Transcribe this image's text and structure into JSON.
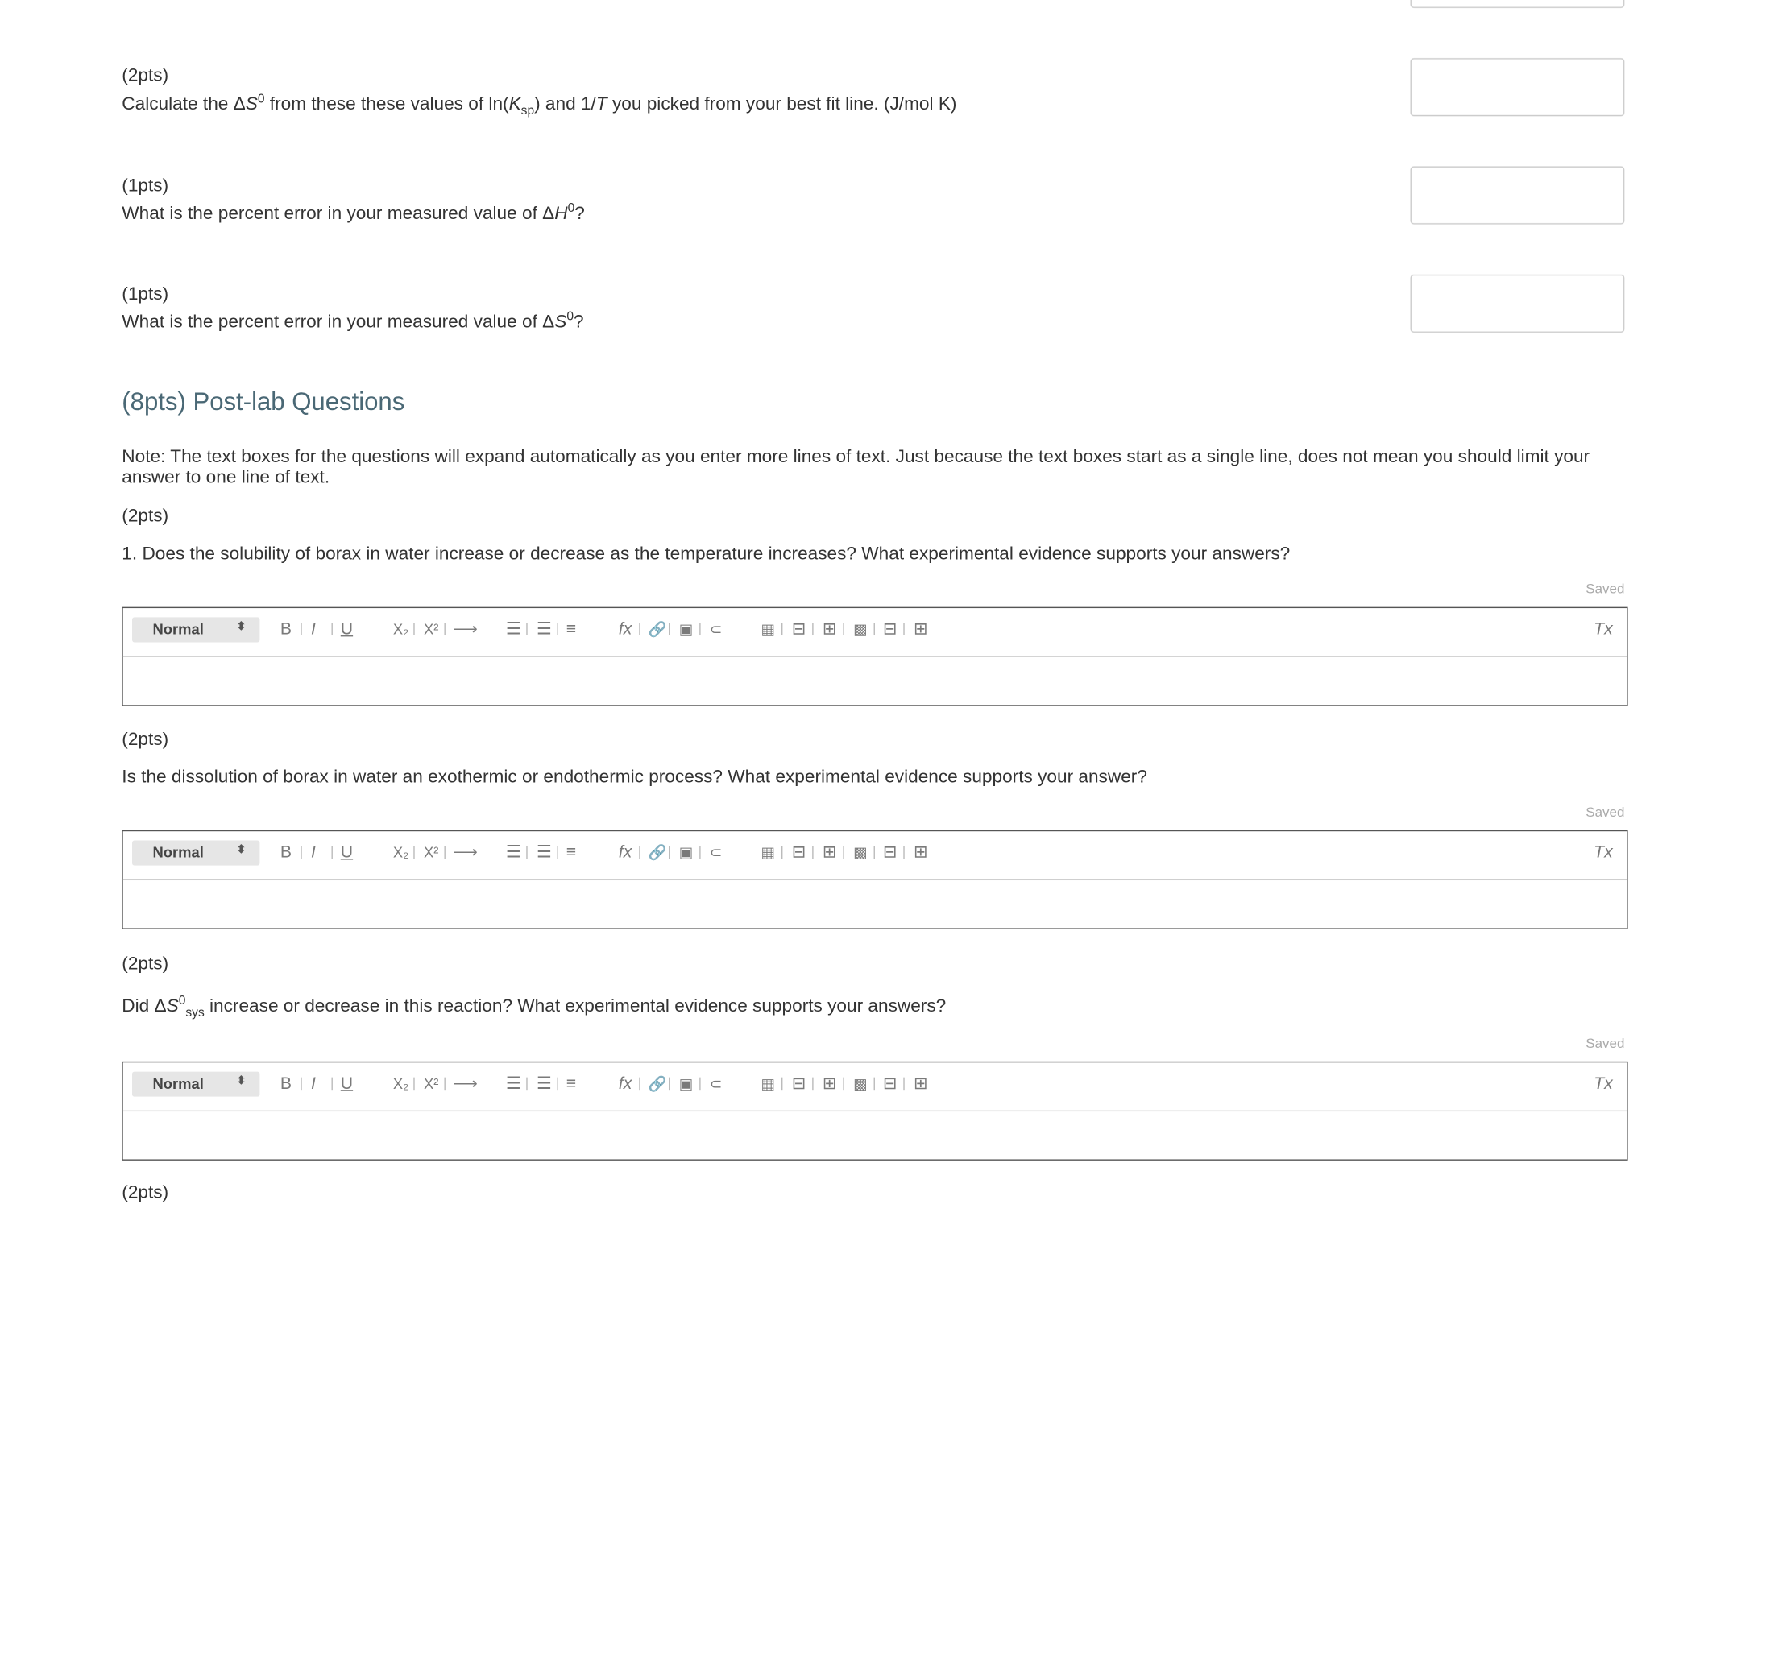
{
  "questions": [
    {
      "points": "(2pts)",
      "text": "Calculate the ΔS⁰ from these these values of ln(Ksp) and 1/T you picked from your best fit line. (J/mol K)"
    },
    {
      "points": "(1pts)",
      "text": "What is the percent error in your measured value of ΔH⁰?"
    },
    {
      "points": "(1pts)",
      "text": "What is the percent error in your measured value of ΔS⁰?"
    }
  ],
  "q1_parts": {
    "a": "Calculate the Δ",
    "b": "S",
    "c": "0",
    "d": " from these these values of ln(",
    "e": "K",
    "f": "sp",
    "g": ") and 1/",
    "h": "T",
    "i": " you picked from your best fit line. (J/mol K)"
  },
  "q2_parts": {
    "a": "What is the percent error in your measured value of Δ",
    "b": "H",
    "c": "0",
    "d": "?"
  },
  "q3_parts": {
    "a": "What is the percent error in your measured value of Δ",
    "b": "S",
    "c": "0",
    "d": "?"
  },
  "postlab": {
    "heading": "(8pts) Post-lab Questions",
    "note": "Note: The text boxes for the questions will expand automatically as you enter more lines of text. Just because the text boxes start as a single line, does not mean you should limit your answer to one line of text.",
    "items": [
      {
        "points": "(2pts)",
        "text": "1. Does the solubility of borax in water increase or decrease as the temperature increases? What experimental evidence supports your answers?",
        "status": "Saved"
      },
      {
        "points": "(2pts)",
        "text": "Is the dissolution of borax in water an exothermic or endothermic process? What experimental evidence supports your answer?",
        "status": "Saved"
      },
      {
        "points": "(2pts)",
        "status": "Saved"
      }
    ],
    "item3_parts": {
      "a": "Did Δ",
      "b": "S",
      "c": "0",
      "d": "sys",
      "e": " increase or decrease in this reaction? What experimental evidence supports your answers?"
    },
    "next_points": "(2pts)"
  },
  "toolbar": {
    "format_value": "Normal",
    "icons": [
      "bold-icon",
      "italic-icon",
      "underline-icon",
      "subscript-icon",
      "superscript-icon",
      "arrow-icon",
      "ordered-list-icon",
      "bullet-list-icon",
      "align-icon",
      "formula-icon",
      "link-icon",
      "image-icon",
      "attachment-icon",
      "table-icon",
      "insert-row-icon",
      "insert-column-icon",
      "delete-table-icon",
      "delete-row-icon",
      "delete-column-icon",
      "clear-format-icon"
    ],
    "glyphs": {
      "bold": "B",
      "italic": "I",
      "underline": "U",
      "sub": "X₂",
      "sup": "X²",
      "arrow": "⟶",
      "ol": "☰",
      "ul": "☰",
      "align": "≡",
      "formula": "fx",
      "link": "🔗",
      "image": "▣",
      "attach": "⊂",
      "table": "▦",
      "row": "⊟",
      "col": "⊞",
      "deltable": "▩",
      "delrow": "⊟",
      "delcol": "⊞",
      "clear": "Tx"
    }
  }
}
